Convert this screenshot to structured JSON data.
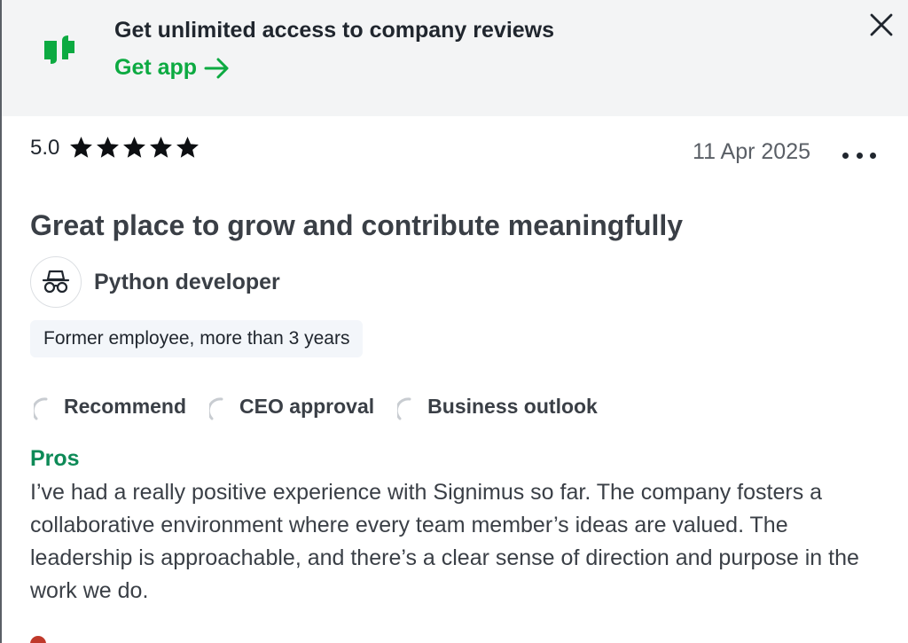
{
  "banner": {
    "title": "Get unlimited access to company reviews",
    "link_label": "Get app",
    "logo_icon": "glassdoor-quote-icon",
    "close_icon": "close-icon",
    "accent_color": "#0caa41",
    "background_color": "#f3f4f5"
  },
  "review": {
    "rating": "5.0",
    "stars": 5,
    "date": "11 Apr 2025",
    "more_icon": "more-options-icon",
    "title": "Great place to grow and contribute meaningfully",
    "author": {
      "avatar_icon": "anonymous-incognito-icon",
      "role": "Python developer"
    },
    "tenure": "Former employee, more than 3 years",
    "ratings": [
      {
        "label": "Recommend",
        "icon": "neutral-ring-icon"
      },
      {
        "label": "CEO approval",
        "icon": "neutral-ring-icon"
      },
      {
        "label": "Business outlook",
        "icon": "neutral-ring-icon"
      }
    ],
    "pros": {
      "heading": "Pros",
      "heading_color": "#0d8a57",
      "text": "I’ve had a really positive experience with Signimus so far. The company fosters a collaborative environment where every team member’s ideas are valued. The leadership is approachable, and there’s a clear sense of direction and purpose in the work we do."
    }
  }
}
